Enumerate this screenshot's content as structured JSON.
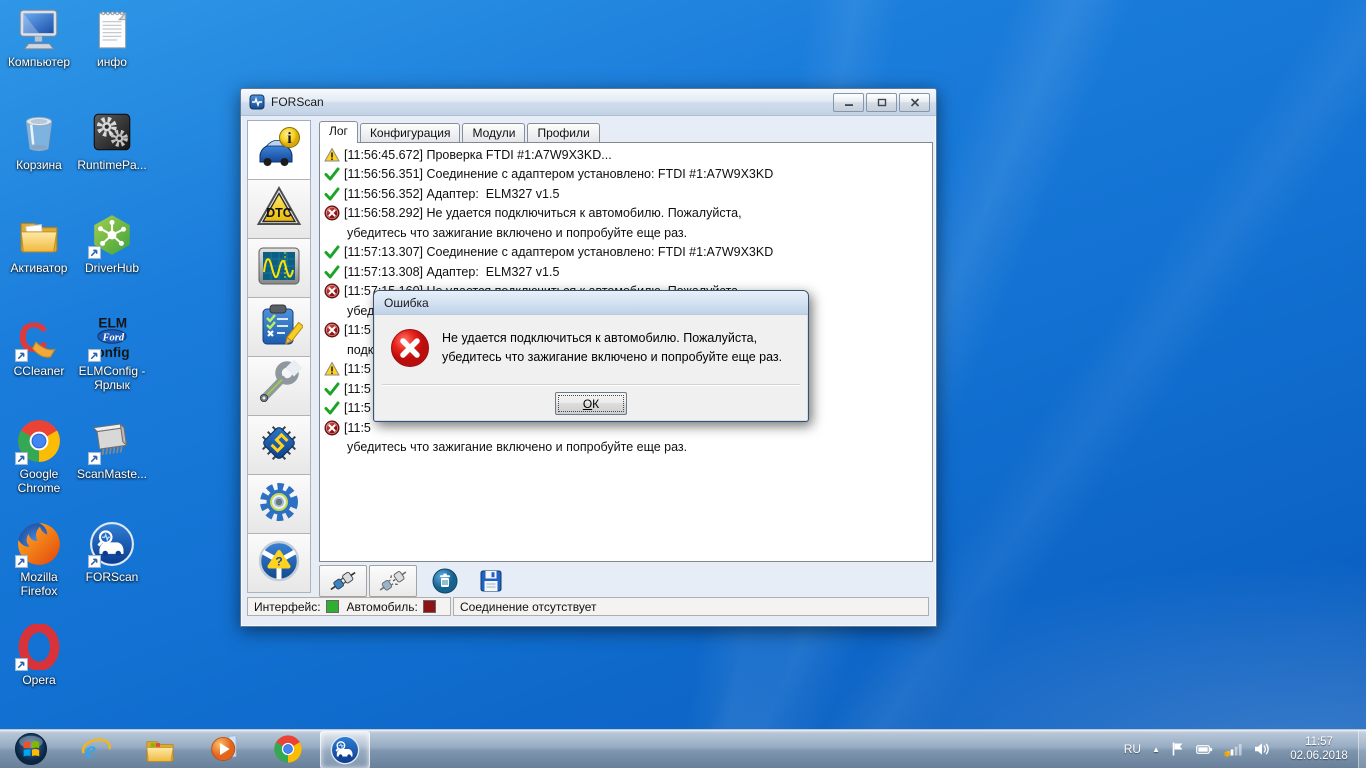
{
  "desktop": {
    "icons": [
      {
        "name": "computer-icon",
        "label": "Компьютер",
        "shortcut": false
      },
      {
        "name": "notepad-icon",
        "label": "инфо",
        "shortcut": false
      },
      {
        "name": "recycle-bin-icon",
        "label": "Корзина",
        "shortcut": false
      },
      {
        "name": "runtimepack-icon",
        "label": "RuntimePa...",
        "shortcut": false
      },
      {
        "name": "folder-icon",
        "label": "Активатор",
        "shortcut": false
      },
      {
        "name": "driverhub-icon",
        "label": "DriverHub",
        "shortcut": true
      },
      {
        "name": "ccleaner-icon",
        "label": "CCleaner",
        "shortcut": true
      },
      {
        "name": "elmconfig-icon",
        "label": "ELMConfig - Ярлык",
        "shortcut": true
      },
      {
        "name": "chrome-icon",
        "label": "Google Chrome",
        "shortcut": true
      },
      {
        "name": "scanmaster-icon",
        "label": "ScanMaste...",
        "shortcut": true
      },
      {
        "name": "firefox-icon",
        "label": "Mozilla Firefox",
        "shortcut": true
      },
      {
        "name": "forscan-icon",
        "label": "FORScan",
        "shortcut": true
      },
      {
        "name": "opera-icon",
        "label": "Opera",
        "shortcut": true
      }
    ]
  },
  "forscan_window": {
    "title": "FORScan",
    "tabs": [
      {
        "label": "Лог",
        "active": true
      },
      {
        "label": "Конфигурация",
        "active": false
      },
      {
        "label": "Модули",
        "active": false
      },
      {
        "label": "Профили",
        "active": false
      }
    ],
    "sidebar": [
      {
        "name": "vehicle-info-icon",
        "selected": true
      },
      {
        "name": "dtc-icon",
        "selected": false
      },
      {
        "name": "oscilloscope-icon",
        "selected": false
      },
      {
        "name": "tests-icon",
        "selected": false
      },
      {
        "name": "service-icon",
        "selected": false
      },
      {
        "name": "programming-icon",
        "selected": false
      },
      {
        "name": "settings-icon",
        "selected": false
      },
      {
        "name": "help-icon",
        "selected": false
      }
    ],
    "log_lines": [
      {
        "icon": "warning",
        "text": "[11:56:45.672] Проверка FTDI #1:A7W9X3KD...",
        "indent": false
      },
      {
        "icon": "success",
        "text": "[11:56:56.351] Соединение с адаптером установлено: FTDI #1:A7W9X3KD",
        "indent": false
      },
      {
        "icon": "success",
        "text": "[11:56:56.352] Адаптер:  ELM327 v1.5",
        "indent": false
      },
      {
        "icon": "error",
        "text": "[11:56:58.292] Не удается подключиться к автомобилю. Пожалуйста,",
        "indent": false
      },
      {
        "icon": null,
        "text": "убедитесь что зажигание включено и попробуйте еще раз.",
        "indent": true
      },
      {
        "icon": "success",
        "text": "[11:57:13.307] Соединение с адаптером установлено: FTDI #1:A7W9X3KD",
        "indent": false
      },
      {
        "icon": "success",
        "text": "[11:57:13.308] Адаптер:  ELM327 v1.5",
        "indent": false
      },
      {
        "icon": "error",
        "text": "[11:57:15.160] Не удается подключиться к автомобилю. Пожалуйста,",
        "indent": false
      },
      {
        "icon": null,
        "text": "убедитесь что зажигание включено и попробуйте еще раз.",
        "indent": true
      },
      {
        "icon": "error",
        "text": "[11:5",
        "indent": false
      },
      {
        "icon": null,
        "text": "подкл",
        "indent": true
      },
      {
        "icon": "warning",
        "text": "[11:5",
        "indent": false
      },
      {
        "icon": "success",
        "text": "[11:5",
        "indent": false
      },
      {
        "icon": "success",
        "text": "[11:5",
        "indent": false
      },
      {
        "icon": "error",
        "text": "[11:5",
        "indent": false
      },
      {
        "icon": null,
        "text": "убедитесь что зажигание включено и попробуйте еще раз.",
        "indent": true
      }
    ],
    "toolbar": [
      {
        "name": "connect-button",
        "icon": "plug-connect-icon",
        "flat": false
      },
      {
        "name": "disconnect-button",
        "icon": "plug-disconnect-icon",
        "flat": false
      },
      {
        "name": "clear-log-button",
        "icon": "trash-icon",
        "flat": true
      },
      {
        "name": "save-log-button",
        "icon": "save-icon",
        "flat": true
      }
    ],
    "status_bar": {
      "interface_label": "Интерфейс:",
      "interface_color": "#2fae2f",
      "vehicle_label": "Автомобиль:",
      "vehicle_color": "#8c1414",
      "status_text": "Соединение отсутствует"
    }
  },
  "error_dialog": {
    "title": "Ошибка",
    "message_line1": "Не удается подключиться к автомобилю. Пожалуйста,",
    "message_line2": "убедитесь что зажигание включено и попробуйте еще раз.",
    "ok_accel": "О",
    "ok_rest": "К"
  },
  "taskbar": {
    "items": [
      {
        "name": "start-button",
        "icon": "start-icon",
        "active": false
      },
      {
        "name": "taskbar-internet-explorer",
        "icon": "ie-icon",
        "active": false
      },
      {
        "name": "taskbar-windows-explorer",
        "icon": "explorer-icon",
        "active": false
      },
      {
        "name": "taskbar-media-player",
        "icon": "wmp-icon",
        "active": false
      },
      {
        "name": "taskbar-chrome",
        "icon": "chrome-icon",
        "active": false
      },
      {
        "name": "taskbar-forscan",
        "icon": "forscan-icon",
        "active": true
      }
    ],
    "tray": {
      "language": "RU",
      "hidden_icons_arrow": "▲",
      "icons": [
        "flag-icon",
        "battery-icon",
        "network-icon",
        "speaker-icon"
      ],
      "time": "11:57",
      "date": "02.06.2018"
    }
  }
}
